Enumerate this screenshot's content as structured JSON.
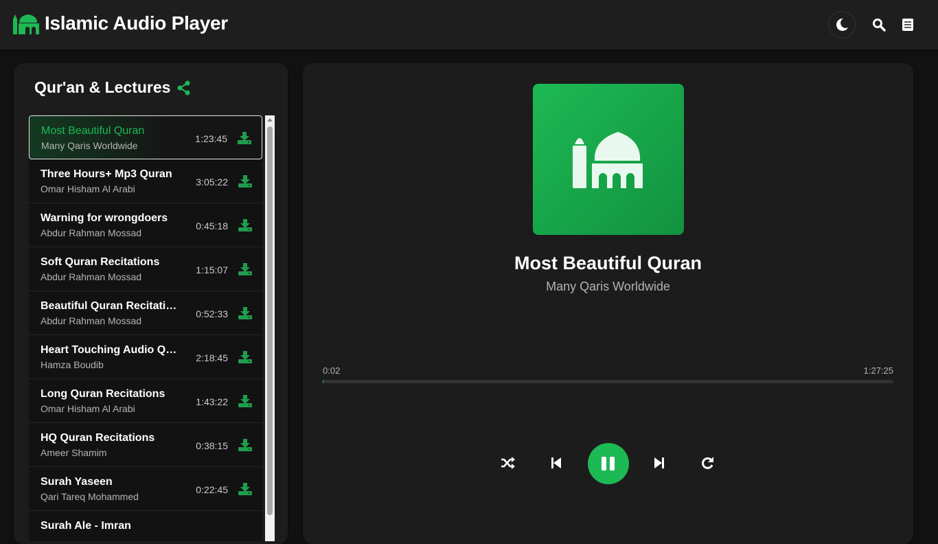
{
  "app": {
    "title": "Islamic Audio Player",
    "accent": "#1db954"
  },
  "header": {
    "icons": [
      "moon-icon",
      "search-icon",
      "list-icon"
    ]
  },
  "playlist": {
    "title": "Qur'an & Lectures",
    "items": [
      {
        "title": "Most Beautiful Quran",
        "artist": "Many Qaris Worldwide",
        "duration": "1:23:45",
        "active": true
      },
      {
        "title": "Three Hours+ Mp3 Quran",
        "artist": "Omar Hisham Al Arabi",
        "duration": "3:05:22"
      },
      {
        "title": "Warning for wrongdoers",
        "artist": "Abdur Rahman Mossad",
        "duration": "0:45:18"
      },
      {
        "title": "Soft Quran Recitations",
        "artist": "Abdur Rahman Mossad",
        "duration": "1:15:07"
      },
      {
        "title": "Beautiful Quran Recitations",
        "artist": "Abdur Rahman Mossad",
        "duration": "0:52:33"
      },
      {
        "title": "Heart Touching Audio Quran",
        "artist": "Hamza Boudib",
        "duration": "2:18:45"
      },
      {
        "title": "Long Quran Recitations",
        "artist": "Omar Hisham Al Arabi",
        "duration": "1:43:22"
      },
      {
        "title": "HQ Quran Recitations",
        "artist": "Ameer Shamim",
        "duration": "0:38:15"
      },
      {
        "title": "Surah Yaseen",
        "artist": "Qari Tareq Mohammed",
        "duration": "0:22:45"
      },
      {
        "title": "Surah Ale - Imran",
        "artist": "",
        "duration": ""
      }
    ]
  },
  "player": {
    "title": "Most Beautiful Quran",
    "artist": "Many Qaris Worldwide",
    "current_time": "0:02",
    "total_time": "1:27:25",
    "progress_percent": 0.1,
    "state": "playing"
  }
}
